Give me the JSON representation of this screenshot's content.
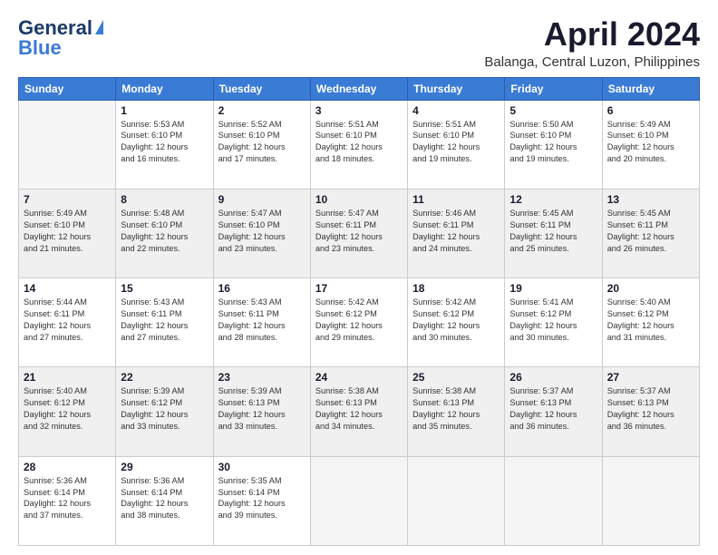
{
  "logo": {
    "line1": "General",
    "line2": "Blue"
  },
  "title": "April 2024",
  "location": "Balanga, Central Luzon, Philippines",
  "header_days": [
    "Sunday",
    "Monday",
    "Tuesday",
    "Wednesday",
    "Thursday",
    "Friday",
    "Saturday"
  ],
  "weeks": [
    [
      {
        "day": "",
        "info": ""
      },
      {
        "day": "1",
        "info": "Sunrise: 5:53 AM\nSunset: 6:10 PM\nDaylight: 12 hours\nand 16 minutes."
      },
      {
        "day": "2",
        "info": "Sunrise: 5:52 AM\nSunset: 6:10 PM\nDaylight: 12 hours\nand 17 minutes."
      },
      {
        "day": "3",
        "info": "Sunrise: 5:51 AM\nSunset: 6:10 PM\nDaylight: 12 hours\nand 18 minutes."
      },
      {
        "day": "4",
        "info": "Sunrise: 5:51 AM\nSunset: 6:10 PM\nDaylight: 12 hours\nand 19 minutes."
      },
      {
        "day": "5",
        "info": "Sunrise: 5:50 AM\nSunset: 6:10 PM\nDaylight: 12 hours\nand 19 minutes."
      },
      {
        "day": "6",
        "info": "Sunrise: 5:49 AM\nSunset: 6:10 PM\nDaylight: 12 hours\nand 20 minutes."
      }
    ],
    [
      {
        "day": "7",
        "info": "Sunrise: 5:49 AM\nSunset: 6:10 PM\nDaylight: 12 hours\nand 21 minutes."
      },
      {
        "day": "8",
        "info": "Sunrise: 5:48 AM\nSunset: 6:10 PM\nDaylight: 12 hours\nand 22 minutes."
      },
      {
        "day": "9",
        "info": "Sunrise: 5:47 AM\nSunset: 6:10 PM\nDaylight: 12 hours\nand 23 minutes."
      },
      {
        "day": "10",
        "info": "Sunrise: 5:47 AM\nSunset: 6:11 PM\nDaylight: 12 hours\nand 23 minutes."
      },
      {
        "day": "11",
        "info": "Sunrise: 5:46 AM\nSunset: 6:11 PM\nDaylight: 12 hours\nand 24 minutes."
      },
      {
        "day": "12",
        "info": "Sunrise: 5:45 AM\nSunset: 6:11 PM\nDaylight: 12 hours\nand 25 minutes."
      },
      {
        "day": "13",
        "info": "Sunrise: 5:45 AM\nSunset: 6:11 PM\nDaylight: 12 hours\nand 26 minutes."
      }
    ],
    [
      {
        "day": "14",
        "info": "Sunrise: 5:44 AM\nSunset: 6:11 PM\nDaylight: 12 hours\nand 27 minutes."
      },
      {
        "day": "15",
        "info": "Sunrise: 5:43 AM\nSunset: 6:11 PM\nDaylight: 12 hours\nand 27 minutes."
      },
      {
        "day": "16",
        "info": "Sunrise: 5:43 AM\nSunset: 6:11 PM\nDaylight: 12 hours\nand 28 minutes."
      },
      {
        "day": "17",
        "info": "Sunrise: 5:42 AM\nSunset: 6:12 PM\nDaylight: 12 hours\nand 29 minutes."
      },
      {
        "day": "18",
        "info": "Sunrise: 5:42 AM\nSunset: 6:12 PM\nDaylight: 12 hours\nand 30 minutes."
      },
      {
        "day": "19",
        "info": "Sunrise: 5:41 AM\nSunset: 6:12 PM\nDaylight: 12 hours\nand 30 minutes."
      },
      {
        "day": "20",
        "info": "Sunrise: 5:40 AM\nSunset: 6:12 PM\nDaylight: 12 hours\nand 31 minutes."
      }
    ],
    [
      {
        "day": "21",
        "info": "Sunrise: 5:40 AM\nSunset: 6:12 PM\nDaylight: 12 hours\nand 32 minutes."
      },
      {
        "day": "22",
        "info": "Sunrise: 5:39 AM\nSunset: 6:12 PM\nDaylight: 12 hours\nand 33 minutes."
      },
      {
        "day": "23",
        "info": "Sunrise: 5:39 AM\nSunset: 6:13 PM\nDaylight: 12 hours\nand 33 minutes."
      },
      {
        "day": "24",
        "info": "Sunrise: 5:38 AM\nSunset: 6:13 PM\nDaylight: 12 hours\nand 34 minutes."
      },
      {
        "day": "25",
        "info": "Sunrise: 5:38 AM\nSunset: 6:13 PM\nDaylight: 12 hours\nand 35 minutes."
      },
      {
        "day": "26",
        "info": "Sunrise: 5:37 AM\nSunset: 6:13 PM\nDaylight: 12 hours\nand 36 minutes."
      },
      {
        "day": "27",
        "info": "Sunrise: 5:37 AM\nSunset: 6:13 PM\nDaylight: 12 hours\nand 36 minutes."
      }
    ],
    [
      {
        "day": "28",
        "info": "Sunrise: 5:36 AM\nSunset: 6:14 PM\nDaylight: 12 hours\nand 37 minutes."
      },
      {
        "day": "29",
        "info": "Sunrise: 5:36 AM\nSunset: 6:14 PM\nDaylight: 12 hours\nand 38 minutes."
      },
      {
        "day": "30",
        "info": "Sunrise: 5:35 AM\nSunset: 6:14 PM\nDaylight: 12 hours\nand 39 minutes."
      },
      {
        "day": "",
        "info": ""
      },
      {
        "day": "",
        "info": ""
      },
      {
        "day": "",
        "info": ""
      },
      {
        "day": "",
        "info": ""
      }
    ]
  ]
}
